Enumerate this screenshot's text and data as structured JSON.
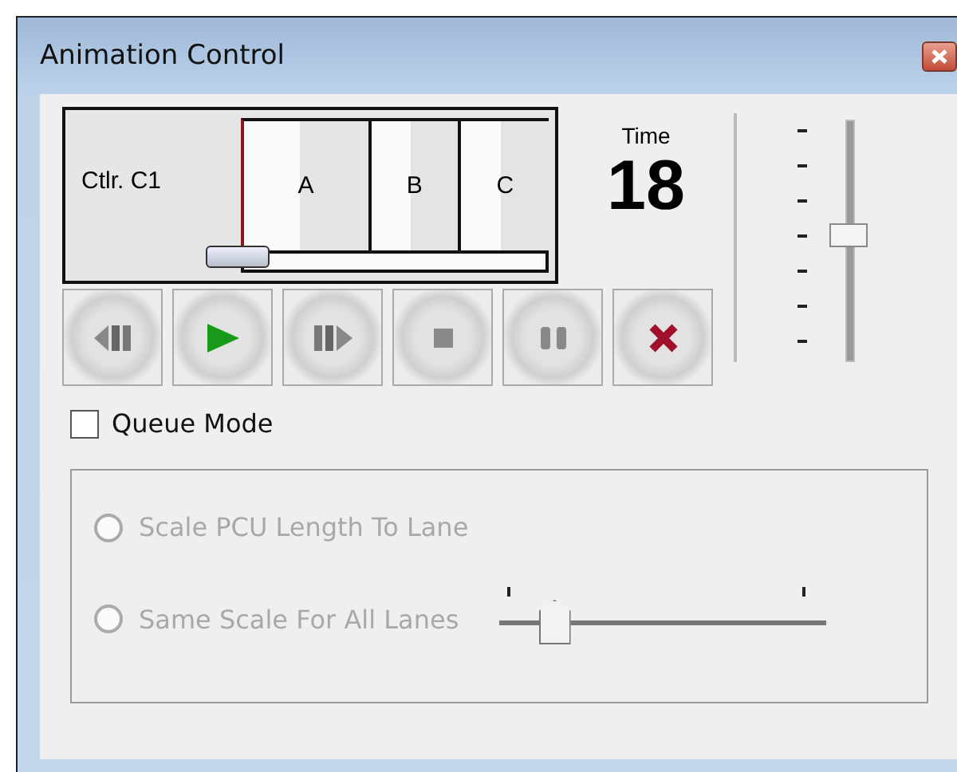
{
  "window": {
    "title": "Animation Control"
  },
  "timeline": {
    "controller": "Ctlr. C1",
    "phases": [
      "A",
      "B",
      "C"
    ]
  },
  "time": {
    "label": "Time",
    "value": "18"
  },
  "speed_slider": {
    "level": 0.5
  },
  "buttons": [
    {
      "kind": "step-back"
    },
    {
      "kind": "play"
    },
    {
      "kind": "step-forward"
    },
    {
      "kind": "stop"
    },
    {
      "kind": "pause"
    },
    {
      "kind": "close"
    }
  ],
  "queue_mode": {
    "label": "Queue Mode",
    "checked": false
  },
  "scale_options": {
    "disabled": true,
    "options": [
      {
        "label": "Scale PCU Length To Lane",
        "selected": false
      },
      {
        "label": "Same Scale For All Lanes",
        "selected": false
      }
    ],
    "slider": {
      "level": 0.18
    }
  }
}
